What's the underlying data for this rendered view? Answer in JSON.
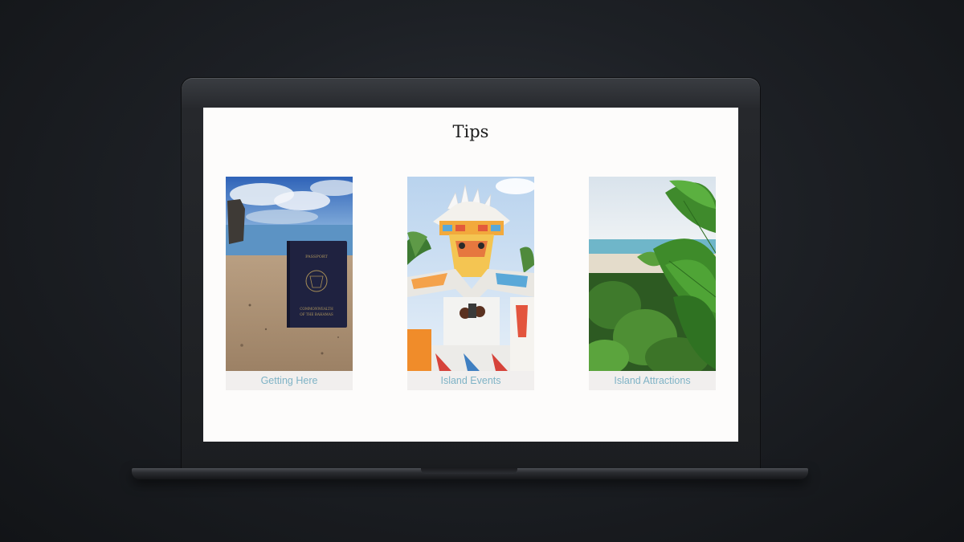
{
  "page": {
    "title": "Tips"
  },
  "cards": [
    {
      "label": "Getting Here",
      "image": "passport-on-beach",
      "passport_text_top": "PASSPORT",
      "passport_text_bottom_1": "COMMONWEALTH",
      "passport_text_bottom_2": "OF THE BAHAMAS"
    },
    {
      "label": "Island Events",
      "image": "junkanoo-costume"
    },
    {
      "label": "Island Attractions",
      "image": "beach-foliage"
    }
  ],
  "colors": {
    "background": "#1d2025",
    "screen": "#fdfcfb",
    "label_text": "#7fb3c6",
    "label_bg": "#f1efee"
  }
}
